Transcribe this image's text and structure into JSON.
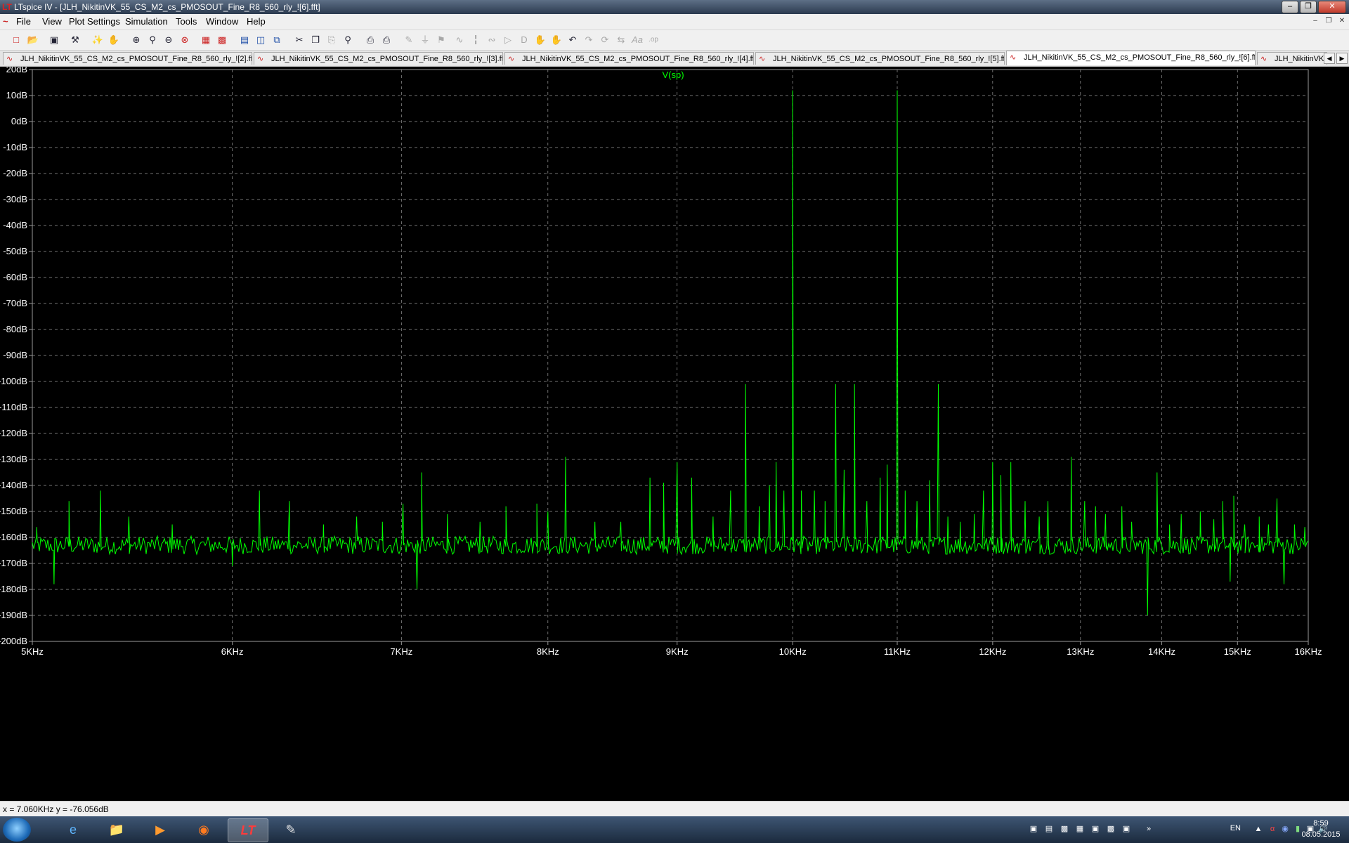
{
  "window": {
    "title": "LTspice IV - [JLH_NikitinVK_55_CS_M2_cs_PMOSOUT_Fine_R8_560_rly_![6].fft]",
    "app_icon": "ltspice-icon",
    "controls": [
      "minimize",
      "restore",
      "close"
    ]
  },
  "menu": [
    "File",
    "View",
    "Plot Settings",
    "Simulation",
    "Tools",
    "Window",
    "Help"
  ],
  "toolbar": {
    "icons": [
      "new-schematic-icon",
      "open-icon",
      "save-icon",
      "control-panel-icon",
      "run-icon",
      "halt-icon",
      "zoom-in-icon",
      "zoom-area-icon",
      "zoom-out-icon",
      "zoom-fit-icon",
      "autorange-icon",
      "probe-icon",
      "tile-horizontal-icon",
      "tile-vertical-icon",
      "cascade-icon",
      "cut-icon",
      "copy-icon",
      "paste-icon",
      "find-icon",
      "print-preview-icon",
      "print-icon",
      "wire-icon",
      "ground-icon",
      "label-icon",
      "resistor-icon",
      "capacitor-icon",
      "inductor-icon",
      "diode-icon",
      "component-icon",
      "move-icon",
      "drag-icon",
      "undo-icon",
      "redo-icon",
      "rotate-icon",
      "mirror-icon",
      "text-icon",
      "spice-directive-icon"
    ]
  },
  "tabs": [
    {
      "label": "JLH_NikitinVK_55_CS_M2_cs_PMOSOUT_Fine_R8_560_rly_![2].fft",
      "active": false
    },
    {
      "label": "JLH_NikitinVK_55_CS_M2_cs_PMOSOUT_Fine_R8_560_rly_![3].fft",
      "active": false
    },
    {
      "label": "JLH_NikitinVK_55_CS_M2_cs_PMOSOUT_Fine_R8_560_rly_![4].fft",
      "active": false
    },
    {
      "label": "JLH_NikitinVK_55_CS_M2_cs_PMOSOUT_Fine_R8_560_rly_![5].fft",
      "active": false
    },
    {
      "label": "JLH_NikitinVK_55_CS_M2_cs_PMOSOUT_Fine_R8_560_rly_![6].fft",
      "active": true
    },
    {
      "label": "JLH_NikitinVK",
      "active": false
    }
  ],
  "status": {
    "cursor": "x = 7.060KHz   y = -76.056dB"
  },
  "taskbar": {
    "apps": [
      "internet-explorer-icon",
      "file-explorer-icon",
      "media-player-icon",
      "firefox-icon",
      "ltspice-icon",
      "paint-icon"
    ],
    "active_app": "ltspice-icon",
    "language": "EN",
    "time": "8:59",
    "date": "08.05.2015"
  },
  "colors": {
    "trace": "#00ff00",
    "grid": "#9a9a9a",
    "axis_text": "#ffffff",
    "background": "#000000"
  },
  "chart_data": {
    "type": "line",
    "trace_label": "V(sp)",
    "x_scale": "log",
    "x_range_hz": [
      5000,
      16000
    ],
    "y_range_db": [
      -200,
      20
    ],
    "x_ticks": [
      {
        "label": "5KHz",
        "value": 5000
      },
      {
        "label": "6KHz",
        "value": 6000
      },
      {
        "label": "7KHz",
        "value": 7000
      },
      {
        "label": "8KHz",
        "value": 8000
      },
      {
        "label": "9KHz",
        "value": 9000
      },
      {
        "label": "10KHz",
        "value": 10000
      },
      {
        "label": "11KHz",
        "value": 11000
      },
      {
        "label": "12KHz",
        "value": 12000
      },
      {
        "label": "13KHz",
        "value": 13000
      },
      {
        "label": "14KHz",
        "value": 14000
      },
      {
        "label": "15KHz",
        "value": 15000
      },
      {
        "label": "16KHz",
        "value": 16000
      }
    ],
    "y_ticks": [
      {
        "label": "20dB",
        "value": 20
      },
      {
        "label": "10dB",
        "value": 10
      },
      {
        "label": "0dB",
        "value": 0
      },
      {
        "label": "-10dB",
        "value": -10
      },
      {
        "label": "-20dB",
        "value": -20
      },
      {
        "label": "-30dB",
        "value": -30
      },
      {
        "label": "-40dB",
        "value": -40
      },
      {
        "label": "-50dB",
        "value": -50
      },
      {
        "label": "-60dB",
        "value": -60
      },
      {
        "label": "-70dB",
        "value": -70
      },
      {
        "label": "-80dB",
        "value": -80
      },
      {
        "label": "-90dB",
        "value": -90
      },
      {
        "label": "-100dB",
        "value": -100
      },
      {
        "label": "-110dB",
        "value": -110
      },
      {
        "label": "-120dB",
        "value": -120
      },
      {
        "label": "-130dB",
        "value": -130
      },
      {
        "label": "-140dB",
        "value": -140
      },
      {
        "label": "-150dB",
        "value": -150
      },
      {
        "label": "-160dB",
        "value": -160
      },
      {
        "label": "-170dB",
        "value": -170
      },
      {
        "label": "-180dB",
        "value": -180
      },
      {
        "label": "-190dB",
        "value": -190
      },
      {
        "label": "-200dB",
        "value": -200
      }
    ],
    "grid": true,
    "noise_floor_db": -163,
    "peaks": [
      {
        "f": 5020,
        "db": -156
      },
      {
        "f": 5100,
        "db": -178
      },
      {
        "f": 5170,
        "db": -146
      },
      {
        "f": 5320,
        "db": -142
      },
      {
        "f": 5460,
        "db": -152
      },
      {
        "f": 5680,
        "db": -155
      },
      {
        "f": 6000,
        "db": -171
      },
      {
        "f": 6150,
        "db": -142
      },
      {
        "f": 6320,
        "db": -146
      },
      {
        "f": 6520,
        "db": -155
      },
      {
        "f": 6720,
        "db": -152
      },
      {
        "f": 6880,
        "db": -154
      },
      {
        "f": 7010,
        "db": -147
      },
      {
        "f": 7100,
        "db": -180
      },
      {
        "f": 7130,
        "db": -135
      },
      {
        "f": 7300,
        "db": -151
      },
      {
        "f": 7520,
        "db": -154
      },
      {
        "f": 7700,
        "db": -148
      },
      {
        "f": 7920,
        "db": -147
      },
      {
        "f": 8000,
        "db": -150
      },
      {
        "f": 8130,
        "db": -129
      },
      {
        "f": 8350,
        "db": -154
      },
      {
        "f": 8550,
        "db": -154
      },
      {
        "f": 8780,
        "db": -137
      },
      {
        "f": 8890,
        "db": -139
      },
      {
        "f": 9000,
        "db": -131
      },
      {
        "f": 9120,
        "db": -137
      },
      {
        "f": 9300,
        "db": -152
      },
      {
        "f": 9450,
        "db": -142
      },
      {
        "f": 9580,
        "db": -101
      },
      {
        "f": 9700,
        "db": -148
      },
      {
        "f": 9790,
        "db": -140
      },
      {
        "f": 9850,
        "db": -131
      },
      {
        "f": 9920,
        "db": -142
      },
      {
        "f": 10000,
        "db": 12
      },
      {
        "f": 10080,
        "db": -142
      },
      {
        "f": 10200,
        "db": -142
      },
      {
        "f": 10300,
        "db": -146
      },
      {
        "f": 10400,
        "db": -101
      },
      {
        "f": 10480,
        "db": -134
      },
      {
        "f": 10580,
        "db": -101
      },
      {
        "f": 10700,
        "db": -146
      },
      {
        "f": 10830,
        "db": -137
      },
      {
        "f": 10900,
        "db": -132
      },
      {
        "f": 11000,
        "db": 12
      },
      {
        "f": 11080,
        "db": -142
      },
      {
        "f": 11200,
        "db": -146
      },
      {
        "f": 11330,
        "db": -138
      },
      {
        "f": 11420,
        "db": -101
      },
      {
        "f": 11520,
        "db": -152
      },
      {
        "f": 11650,
        "db": -154
      },
      {
        "f": 11800,
        "db": -151
      },
      {
        "f": 11900,
        "db": -142
      },
      {
        "f": 12000,
        "db": -131
      },
      {
        "f": 12090,
        "db": -136
      },
      {
        "f": 12200,
        "db": -131
      },
      {
        "f": 12360,
        "db": -146
      },
      {
        "f": 12520,
        "db": -152
      },
      {
        "f": 12620,
        "db": -146
      },
      {
        "f": 12890,
        "db": -129
      },
      {
        "f": 13050,
        "db": -146
      },
      {
        "f": 13180,
        "db": -148
      },
      {
        "f": 13300,
        "db": -151
      },
      {
        "f": 13500,
        "db": -148
      },
      {
        "f": 13620,
        "db": -154
      },
      {
        "f": 13820,
        "db": -190
      },
      {
        "f": 13940,
        "db": -135
      },
      {
        "f": 14100,
        "db": -155
      },
      {
        "f": 14250,
        "db": -151
      },
      {
        "f": 14500,
        "db": -150
      },
      {
        "f": 14680,
        "db": -153
      },
      {
        "f": 14800,
        "db": -146
      },
      {
        "f": 14900,
        "db": -177
      },
      {
        "f": 14950,
        "db": -144
      },
      {
        "f": 15100,
        "db": -155
      },
      {
        "f": 15300,
        "db": -152
      },
      {
        "f": 15430,
        "db": -155
      },
      {
        "f": 15550,
        "db": -145
      },
      {
        "f": 15650,
        "db": -178
      },
      {
        "f": 15800,
        "db": -155
      },
      {
        "f": 15950,
        "db": -156
      }
    ]
  }
}
